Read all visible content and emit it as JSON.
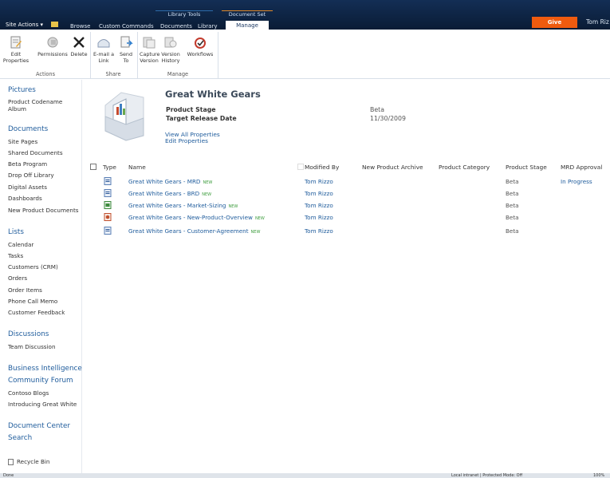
{
  "header": {
    "site_actions": "Site Actions",
    "tabs": [
      "Browse",
      "Custom Commands",
      "Documents",
      "Library",
      "Manage"
    ],
    "context_groups": [
      "Library Tools",
      "Document Set"
    ],
    "give_feedback": "Give Feedback",
    "user": "Tom Riz"
  },
  "ribbon": {
    "buttons": [
      {
        "label1": "Edit",
        "label2": "Properties",
        "icon": "edit-icon"
      },
      {
        "label1": "Permissions",
        "label2": "",
        "icon": "permissions-icon"
      },
      {
        "label1": "Delete",
        "label2": "",
        "icon": "delete-icon"
      },
      {
        "label1": "E-mail a",
        "label2": "Link",
        "icon": "email-icon"
      },
      {
        "label1": "Send",
        "label2": "To",
        "icon": "send-to-icon"
      },
      {
        "label1": "Capture",
        "label2": "Version",
        "icon": "capture-icon"
      },
      {
        "label1": "Version",
        "label2": "History",
        "icon": "history-icon"
      },
      {
        "label1": "Workflows",
        "label2": "",
        "icon": "workflows-icon"
      }
    ],
    "groups": [
      "Actions",
      "Share",
      "Manage"
    ]
  },
  "leftnav": {
    "pictures_head": "Pictures",
    "pictures_items": [
      "Product Codename",
      "Album"
    ],
    "documents_head": "Documents",
    "documents_items": [
      "Site Pages",
      "Shared Documents",
      "Beta Program",
      "Drop Off Library",
      "Digital Assets",
      "Dashboards",
      "New Product Documents"
    ],
    "lists_head": "Lists",
    "lists_items": [
      "Calendar",
      "Tasks",
      "Customers (CRM)",
      "Orders",
      "Order Items",
      "Phone Call Memo",
      "Customer Feedback"
    ],
    "discussions_head": "Discussions",
    "discussions_items": [
      "Team Discussion"
    ],
    "bi_head": "Business Intelligence",
    "community_head": "Community Forum",
    "community_items": [
      "Contoso Blogs",
      "Introducing Great White"
    ],
    "doc_center_head": "Document Center",
    "search_head": "Search",
    "recycle_bin": "Recycle Bin"
  },
  "docset": {
    "title": "Great White Gears",
    "prop1_label": "Product Stage",
    "prop1_value": "Beta",
    "prop2_label": "Target Release Date",
    "prop2_value": "11/30/2009",
    "view_all": "View All Properties",
    "edit_props": "Edit Properties"
  },
  "table": {
    "headers": [
      "Type",
      "Name",
      "Modified By",
      "New Product Archive",
      "Product Category",
      "Product Stage",
      "MRD Approval"
    ],
    "rows": [
      {
        "name": "Great White Gears - MRD",
        "new": "NEW",
        "modified_by": "Tom Rizzo",
        "stage": "Beta",
        "approval": "In Progress"
      },
      {
        "name": "Great White Gears - BRD",
        "new": "NEW",
        "modified_by": "Tom Rizzo",
        "stage": "Beta",
        "approval": ""
      },
      {
        "name": "Great White Gears - Market-Sizing",
        "new": "NEW",
        "modified_by": "Tom Rizzo",
        "stage": "Beta",
        "approval": ""
      },
      {
        "name": "Great White Gears - New-Product-Overview",
        "new": "NEW",
        "modified_by": "Tom Rizzo",
        "stage": "Beta",
        "approval": ""
      },
      {
        "name": "Great White Gears - Customer-Agreement",
        "new": "NEW",
        "modified_by": "Tom Rizzo",
        "stage": "Beta",
        "approval": ""
      }
    ]
  },
  "statusbar": {
    "left": "Done",
    "zone": "Local intranet | Protected Mode: Off",
    "zoom": "100%"
  }
}
